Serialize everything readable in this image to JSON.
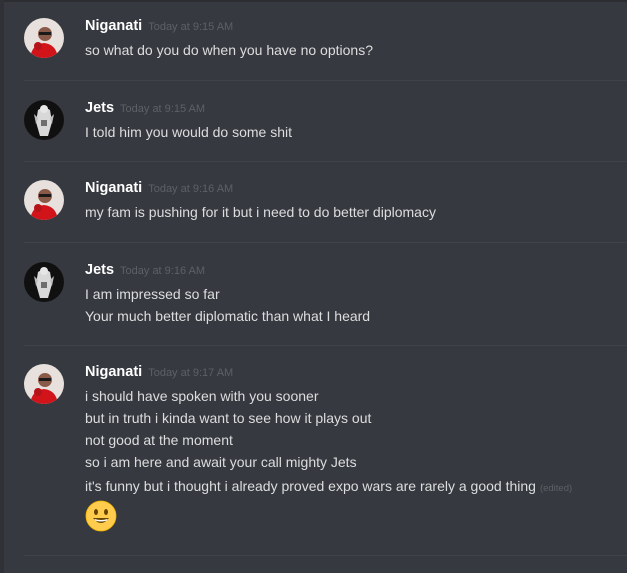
{
  "messages": [
    {
      "username": "Niganati",
      "timestamp": "Today at 9:15 AM",
      "avatar_icon": "niganati-avatar-icon",
      "lines": [
        "so what do you do when you have no options?"
      ]
    },
    {
      "username": "Jets",
      "timestamp": "Today at 9:15 AM",
      "avatar_icon": "jets-avatar-icon",
      "lines": [
        "I told him you would do some shit"
      ]
    },
    {
      "username": "Niganati",
      "timestamp": "Today at 9:16 AM",
      "avatar_icon": "niganati-avatar-icon",
      "lines": [
        "my fam is pushing for it but i need to do better diplomacy"
      ]
    },
    {
      "username": "Jets",
      "timestamp": "Today at 9:16 AM",
      "avatar_icon": "jets-avatar-icon",
      "lines": [
        "I am impressed so far",
        "Your much better diplomatic than what I heard"
      ]
    },
    {
      "username": "Niganati",
      "timestamp": "Today at 9:17 AM",
      "avatar_icon": "niganati-avatar-icon",
      "lines": [
        "i should have spoken with you sooner",
        "but in truth i kinda want to see how it plays out",
        "not good at the moment",
        "so i am here and await your call mighty Jets",
        "it's funny but i thought i already proved expo wars are rarely a good thing"
      ],
      "edited_label": "(edited)",
      "emoji_icon": "smiley-emoji-icon"
    }
  ]
}
